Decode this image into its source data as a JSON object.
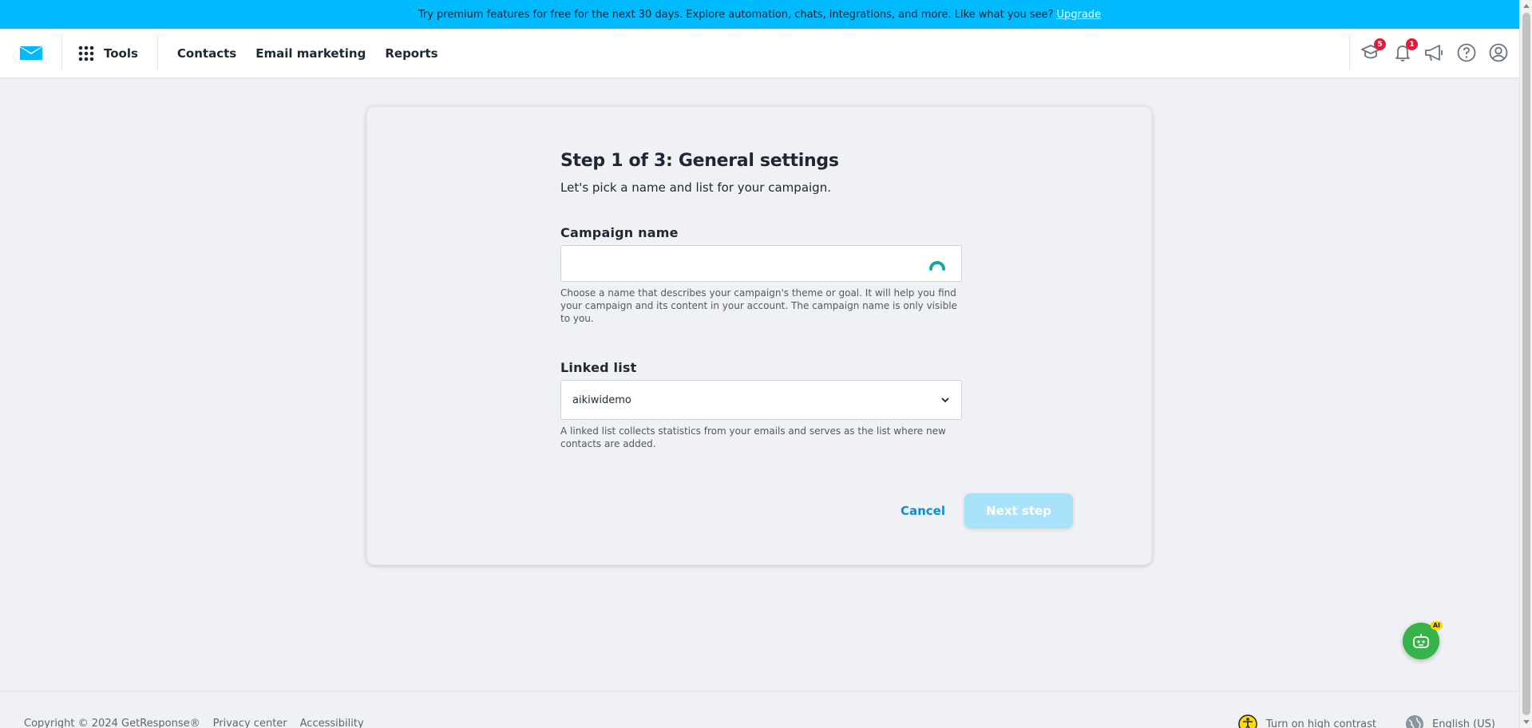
{
  "promo": {
    "text": "Try premium features for free for the next 30 days. Explore automation, chats, integrations, and more. Like what you see?",
    "link": "Upgrade"
  },
  "nav": {
    "tools_label": "Tools",
    "items": [
      {
        "label": "Contacts"
      },
      {
        "label": "Email marketing"
      },
      {
        "label": "Reports"
      }
    ]
  },
  "icons": {
    "courses_badge": "5",
    "notifications_badge": "1"
  },
  "form": {
    "title": "Step 1 of 3: General settings",
    "subtitle": "Let's pick a name and list for your campaign.",
    "campaign_name_label": "Campaign name",
    "campaign_name_value": "",
    "campaign_name_hint": "Choose a name that describes your campaign's theme or goal. It will help you find your campaign and its content in your account. The campaign name is only visible to you.",
    "linked_list_label": "Linked list",
    "linked_list_value": "aikiwidemo",
    "linked_list_hint": "A linked list collects statistics from your emails and serves as the list where new contacts are added.",
    "cancel_label": "Cancel",
    "next_label": "Next step"
  },
  "assistant": {
    "badge": "AI"
  },
  "footer": {
    "copyright": "Copyright © 2024 GetResponse®",
    "privacy": "Privacy center",
    "accessibility": "Accessibility",
    "contrast": "Turn on high contrast",
    "language": "English (US)"
  },
  "colors": {
    "brand": "#00baff",
    "link": "#0a8fd6",
    "badge": "#e6193c",
    "assistant": "#36b44a"
  }
}
